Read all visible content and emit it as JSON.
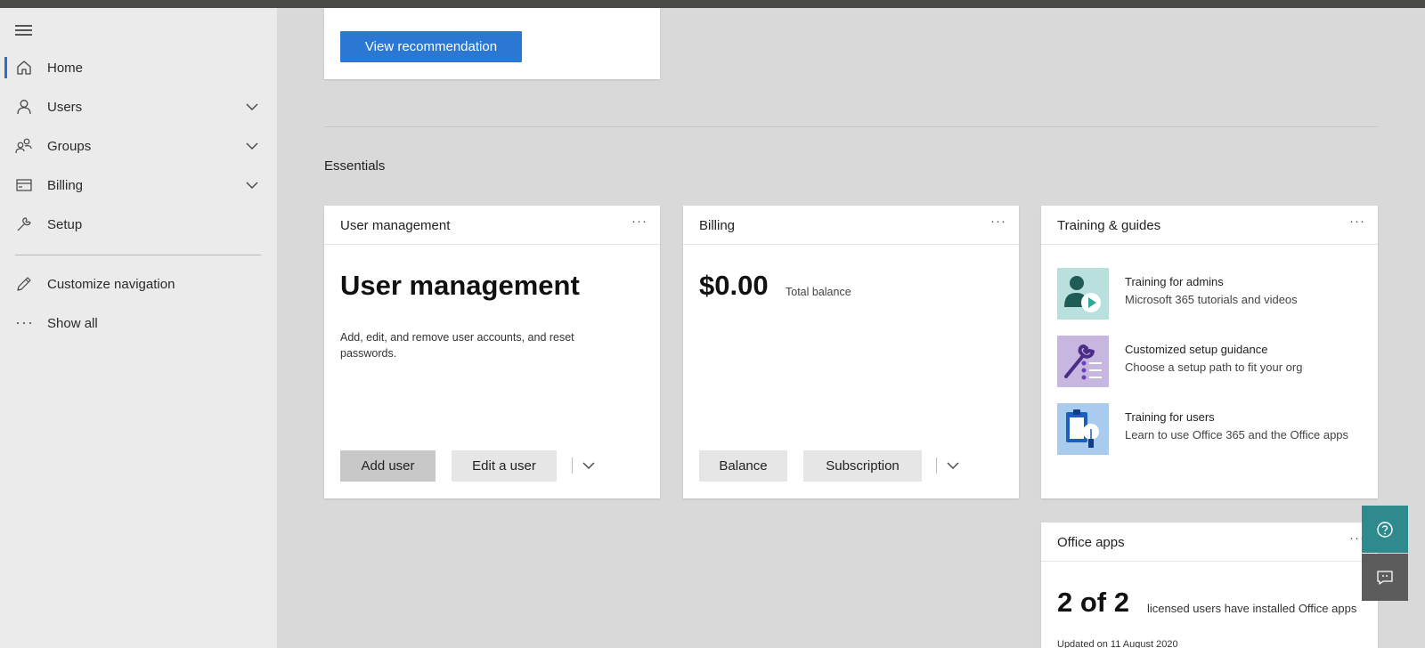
{
  "sidebar": {
    "items": [
      {
        "label": "Home",
        "icon": "home-icon"
      },
      {
        "label": "Users",
        "icon": "user-icon"
      },
      {
        "label": "Groups",
        "icon": "groups-icon"
      },
      {
        "label": "Billing",
        "icon": "billing-card-icon"
      },
      {
        "label": "Setup",
        "icon": "wrench-icon"
      }
    ],
    "customize": "Customize navigation",
    "show_all": "Show all"
  },
  "recommendation": {
    "button": "View recommendation"
  },
  "essentials": {
    "title": "Essentials"
  },
  "user_management": {
    "card_title": "User management",
    "heading": "User management",
    "description": "Add, edit, and remove user accounts, and reset passwords.",
    "add_user": "Add user",
    "edit_user": "Edit a user",
    "more": "···"
  },
  "billing": {
    "card_title": "Billing",
    "amount": "$0.00",
    "amount_label": "Total balance",
    "balance_btn": "Balance",
    "subscription_btn": "Subscription",
    "more": "···"
  },
  "training": {
    "card_title": "Training & guides",
    "more": "···",
    "items": [
      {
        "title": "Training for admins",
        "subtitle": "Microsoft 365 tutorials and videos"
      },
      {
        "title": "Customized setup guidance",
        "subtitle": "Choose a setup path to fit your org"
      },
      {
        "title": "Training for users",
        "subtitle": "Learn to use Office 365 and the Office apps"
      }
    ]
  },
  "office_apps": {
    "card_title": "Office apps",
    "count": "2 of 2",
    "label": "licensed users have installed Office apps",
    "updated": "Updated on 11 August 2020",
    "more": "···"
  },
  "colors": {
    "accent": "#2b78d4",
    "help_button": "#2f8a8e",
    "feedback_button": "#5c5c5c"
  }
}
